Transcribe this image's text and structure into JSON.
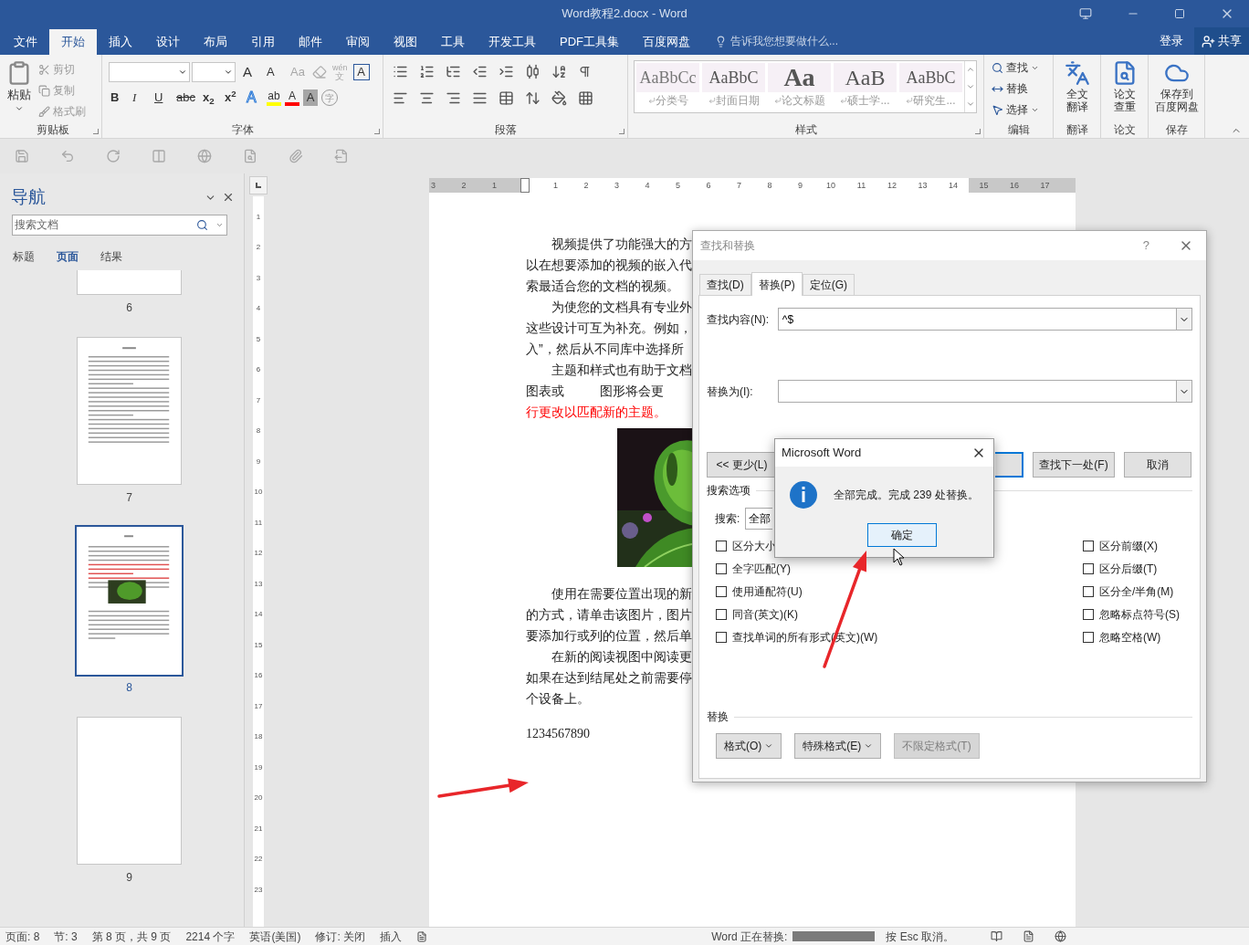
{
  "window": {
    "title": "Word教程2.docx - Word"
  },
  "ribbon_tabs": [
    {
      "label": "文件",
      "selected": false
    },
    {
      "label": "开始",
      "selected": true
    },
    {
      "label": "插入",
      "selected": false
    },
    {
      "label": "设计",
      "selected": false
    },
    {
      "label": "布局",
      "selected": false
    },
    {
      "label": "引用",
      "selected": false
    },
    {
      "label": "邮件",
      "selected": false
    },
    {
      "label": "审阅",
      "selected": false
    },
    {
      "label": "视图",
      "selected": false
    },
    {
      "label": "工具",
      "selected": false
    },
    {
      "label": "开发工具",
      "selected": false
    },
    {
      "label": "PDF工具集",
      "selected": false
    },
    {
      "label": "百度网盘",
      "selected": false
    }
  ],
  "tell_me": {
    "placeholder": "告诉我您想要做什么..."
  },
  "sign_in": "登录",
  "share": "共享",
  "clipboard": {
    "paste": "粘贴",
    "items": [
      {
        "kind": "cut",
        "label": "剪切",
        "disabled": true
      },
      {
        "kind": "copy",
        "label": "复制",
        "disabled": true
      },
      {
        "kind": "painter",
        "label": "格式刷",
        "disabled": true
      }
    ],
    "group": "剪贴板"
  },
  "font": {
    "row1": [
      {
        "kind": "grow",
        "label": "A",
        "disabled": false
      },
      {
        "kind": "shrink",
        "label": "A",
        "disabled": false
      },
      {
        "kind": "case",
        "label": "Aa",
        "disabled": true
      },
      {
        "kind": "clear",
        "disabled": true
      },
      {
        "kind": "phonetic",
        "label": "wén",
        "sub": "文",
        "disabled": true
      },
      {
        "kind": "border",
        "label": "A",
        "disabled": false
      }
    ],
    "row2": [
      {
        "kind": "bold",
        "label": "B"
      },
      {
        "kind": "italic",
        "label": "I"
      },
      {
        "kind": "underline",
        "label": "U"
      },
      {
        "kind": "strike",
        "label": "abc"
      },
      {
        "kind": "script",
        "label": "x$_{2}$"
      },
      {
        "kind": "script",
        "label": "x$^{2}$"
      },
      {
        "kind": "effects",
        "label": "A"
      },
      {
        "kind": "highlight",
        "label": "ab",
        "color": "#ffff00"
      },
      {
        "kind": "fontcolor",
        "label": "A",
        "color": "#ff0000"
      },
      {
        "kind": "shade",
        "label": "A"
      },
      {
        "kind": "enclose",
        "label": "字"
      }
    ],
    "group": "字体"
  },
  "paragraph": {
    "group": "段落"
  },
  "styles": {
    "items": [
      {
        "preview": "AaBbCc",
        "name": "分类号",
        "kind": "light"
      },
      {
        "preview": "AaBbC",
        "name": "封面日期",
        "kind": "mono"
      },
      {
        "preview": "Aa",
        "name": "论文标题",
        "kind": "bold"
      },
      {
        "preview": "AaB",
        "name": "硕士学...",
        "kind": "large"
      },
      {
        "preview": "AaBbC",
        "name": "研究生...",
        "kind": "mono"
      }
    ],
    "group": "样式"
  },
  "editing": {
    "items": [
      {
        "kind": "find",
        "label": "查找",
        "dropdown": true
      },
      {
        "kind": "replace",
        "label": "替换",
        "dropdown": false
      },
      {
        "kind": "select",
        "label": "选择",
        "dropdown": true
      }
    ],
    "group": "编辑"
  },
  "big_groups": [
    {
      "kind": "translate",
      "label_lines": [
        "全文",
        "翻译"
      ],
      "group": "翻译"
    },
    {
      "kind": "check",
      "label_lines": [
        "论文",
        "查重"
      ],
      "group": "论文"
    },
    {
      "kind": "cloud",
      "label_lines": [
        "保存到",
        "百度网盘"
      ],
      "group": "保存"
    }
  ],
  "navigation": {
    "title": "导航",
    "search": {
      "placeholder": "搜索文档"
    },
    "tabs": [
      {
        "label": "标题",
        "selected": false
      },
      {
        "label": "页面",
        "selected": true
      },
      {
        "label": "结果",
        "selected": false
      }
    ],
    "pages": [
      {
        "number": "6",
        "kind": "cut",
        "selected": false
      },
      {
        "number": "7",
        "kind": "text",
        "selected": false
      },
      {
        "number": "8",
        "kind": "picture",
        "selected": true
      },
      {
        "number": "9",
        "kind": "blank",
        "selected": false
      }
    ]
  },
  "ruler": {
    "left_margin_marks": [
      "3",
      "2",
      "1"
    ],
    "marks": [
      "1",
      "2",
      "3",
      "4",
      "5",
      "6",
      "7",
      "8",
      "9",
      "10",
      "11",
      "12",
      "13",
      "14"
    ],
    "right_margin_marks": [
      "15",
      "16",
      "17"
    ],
    "vertical_marks": [
      "1",
      "2",
      "3",
      "4",
      "5",
      "6",
      "7",
      "8",
      "9",
      "10",
      "11",
      "12",
      "13",
      "14",
      "15",
      "16",
      "17",
      "18",
      "19",
      "20",
      "21",
      "22",
      "23"
    ]
  },
  "document": {
    "blocks": [
      {
        "kind": "line",
        "text": "视频提供了功能强大的方",
        "indent": true
      },
      {
        "kind": "line",
        "text": "以在想要添加的视频的嵌入代",
        "indent": false
      },
      {
        "kind": "line",
        "text": "索最适合您的文档的视频。",
        "indent": false
      },
      {
        "kind": "line",
        "text": "为使您的文档具有专业外",
        "indent": true
      },
      {
        "kind": "line",
        "text": "这些设计可互为补充。例如，",
        "indent": false
      },
      {
        "kind": "line",
        "text": "入”，然后从不同库中选择所",
        "indent": false
      },
      {
        "kind": "line",
        "text": "主题和样式也有助于文档",
        "indent": true
      },
      {
        "kind": "line",
        "text": "图表或          图形将会更",
        "indent": false
      },
      {
        "kind": "red_line",
        "text": "行更改以匹配新的主题。",
        "indent": false
      },
      {
        "kind": "picture"
      },
      {
        "kind": "line",
        "text": "使用在需要位置出现的新",
        "indent": true
      },
      {
        "kind": "line",
        "text": "的方式，请单击该图片，图片",
        "indent": false
      },
      {
        "kind": "line",
        "text": "要添加行或列的位置，然后单",
        "indent": false
      },
      {
        "kind": "line",
        "text": "在新的阅读视图中阅读更",
        "indent": true
      },
      {
        "kind": "line",
        "text": "如果在达到结尾处之前需要停",
        "indent": false
      },
      {
        "kind": "line",
        "text": "个设备上。",
        "indent": false
      },
      {
        "kind": "digits",
        "text": "1234567890",
        "indent": false
      }
    ]
  },
  "find_replace": {
    "title": "查找和替换",
    "help": "?",
    "tabs": [
      {
        "label": "查找(D)",
        "selected": false
      },
      {
        "label": "替换(P)",
        "selected": true
      },
      {
        "label": "定位(G)",
        "selected": false
      }
    ],
    "find_label": "查找内容(N):",
    "find_value": "^$",
    "replace_label": "替换为(I):",
    "less_button": "<< 更少(L)",
    "find_next": "查找下一处(F)",
    "cancel": "取消",
    "options_heading": "搜索选项",
    "search_label": "搜索:",
    "search_value": "全部",
    "left_options": [
      {
        "label": "区分大小",
        "checked": false
      },
      {
        "label": "全字匹配(Y)",
        "checked": false
      },
      {
        "label": "使用通配符(U)",
        "checked": false
      },
      {
        "label": "同音(英文)(K)",
        "checked": false
      },
      {
        "label": "查找单词的所有形式(英文)(W)",
        "checked": false
      }
    ],
    "right_options": [
      {
        "label": "区分前缀(X)",
        "checked": false
      },
      {
        "label": "区分后缀(T)",
        "checked": false
      },
      {
        "label": "区分全/半角(M)",
        "checked": false
      },
      {
        "label": "忽略标点符号(S)",
        "checked": false
      },
      {
        "label": "忽略空格(W)",
        "checked": false
      }
    ],
    "replace_heading": "替换",
    "buttons": [
      {
        "label": "格式(O)",
        "dropdown": true,
        "disabled": false
      },
      {
        "label": "特殊格式(E)",
        "dropdown": true,
        "disabled": false
      },
      {
        "label": "不限定格式(T)",
        "dropdown": false,
        "disabled": true
      }
    ]
  },
  "message_box": {
    "title": "Microsoft Word",
    "message": "全部完成。完成 239 处替换。",
    "ok": "确定"
  },
  "status_bar": {
    "items": [
      "页面: 8",
      "节: 3",
      "第 8 页，共 9 页",
      "2214 个字",
      "英语(美国)",
      "修订: 关闭",
      "插入"
    ],
    "progress_label": "Word 正在替换:",
    "progress": {
      "level": 1
    },
    "cancel_hint": "按 Esc 取消。"
  }
}
